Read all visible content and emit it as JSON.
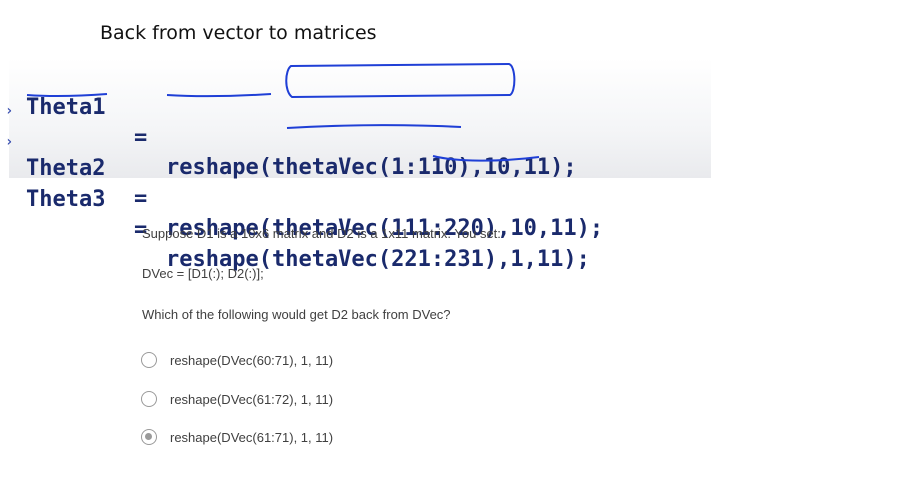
{
  "slide": {
    "title": "Back from vector to matrices",
    "code": [
      {
        "var": "Theta1",
        "eq": "=",
        "expr": "reshape(thetaVec(1:110),10,11);"
      },
      {
        "var": "Theta2",
        "eq": "=",
        "expr": "reshape(thetaVec(111:220),10,11);"
      },
      {
        "var": "Theta3",
        "eq": "=",
        "expr": "reshape(thetaVec(221:231),1,11);"
      }
    ]
  },
  "question": {
    "prompt": "Suppose D1 is a 10x6 matrix and D2 is a 1x11 matrix. You set:",
    "code": "DVec = [D1(:); D2(:)];",
    "ask": "Which of the following would get D2 back from DVec?",
    "options": [
      {
        "label": "reshape(DVec(60:71), 1, 11)",
        "selected": false
      },
      {
        "label": "reshape(DVec(61:72), 1, 11)",
        "selected": false
      },
      {
        "label": "reshape(DVec(61:71), 1, 11)",
        "selected": true
      }
    ]
  },
  "colors": {
    "code_text": "#1a2a6c",
    "annotation_ink": "#1f3fd6",
    "radio_border": "#9a9a9a"
  }
}
